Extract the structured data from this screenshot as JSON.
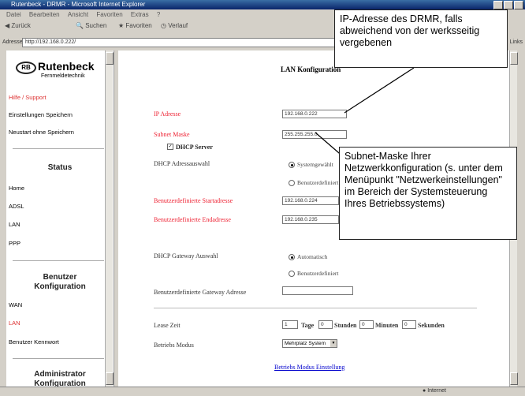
{
  "window": {
    "title": "Rutenbeck - DRMR - Microsoft Internet Explorer"
  },
  "menu": [
    "Datei",
    "Bearbeiten",
    "Ansicht",
    "Favoriten",
    "Extras",
    "?"
  ],
  "toolbar": {
    "back": "Zurück",
    "search": "Suchen",
    "favorites": "Favoriten",
    "history": "Verlauf"
  },
  "address": {
    "label": "Adresse",
    "url": "http://192.168.0.222/",
    "links": "Links"
  },
  "sidebar": {
    "brand": "Rutenbeck",
    "brand_sub": "Fernmeldetechnik",
    "logo_mark": "RB",
    "items_top": [
      "Hilfe / Support",
      "Einstellungen Speichern",
      "Neustart ohne Speichern"
    ],
    "section_status": "Status",
    "items_status": [
      "Home",
      "ADSL",
      "LAN",
      "PPP"
    ],
    "section_benutzer_1": "Benutzer",
    "section_benutzer_2": "Konfiguration",
    "items_benutzer": [
      "WAN",
      "LAN",
      "Benutzer Kennwort"
    ],
    "section_admin_1": "Administrator",
    "section_admin_2": "Konfiguration"
  },
  "main": {
    "title": "LAN Konfiguration",
    "ip_label": "IP Adresse",
    "ip_value": "192.168.0.222",
    "subnet_label": "Subnet Maske",
    "subnet_value": "255.255.255.0",
    "dhcp_server_label": "DHCP Server",
    "dhcp_addr_label": "DHCP Adressauswahl",
    "dhcp_addr_opt1": "Systemgewählt",
    "dhcp_addr_opt2": "Benutzerdefiniert",
    "start_label": "Benutzerdefinierte Startadresse",
    "start_value": "192.168.0.224",
    "end_label": "Benutzerdefinierte Endadresse",
    "end_value": "192.168.0.235",
    "gw_label": "DHCP Gateway Auswahl",
    "gw_opt1": "Automatisch",
    "gw_opt2": "Benutzerdefiniert",
    "gw_addr_label": "Benutzerdefinierte Gateway Adresse",
    "gw_addr_value": "",
    "lease_label": "Lease Zeit",
    "lease_days": "1",
    "lease_days_unit": "Tage",
    "lease_hours": "0",
    "lease_hours_unit": "Stunden",
    "lease_minutes": "0",
    "lease_minutes_unit": "Minuten",
    "lease_seconds": "0",
    "lease_seconds_unit": "Sekunden",
    "mode_label": "Betriebs Modus",
    "mode_value": "Mehrplatz System",
    "mode_link": "Betriebs Modus Einstellung"
  },
  "status": {
    "zone": "Internet"
  },
  "callouts": {
    "ip": "IP-Adresse des DRMR, falls abweichend von der werksseitig vergebenen",
    "subnet": "Subnet-Maske Ihrer Netzwerkkonfiguration (s. unter dem Menüpunkt \"Netzwerkein­stellungen\" im Bereich der Systemsteuerung Ihres Betriebssystems)"
  }
}
